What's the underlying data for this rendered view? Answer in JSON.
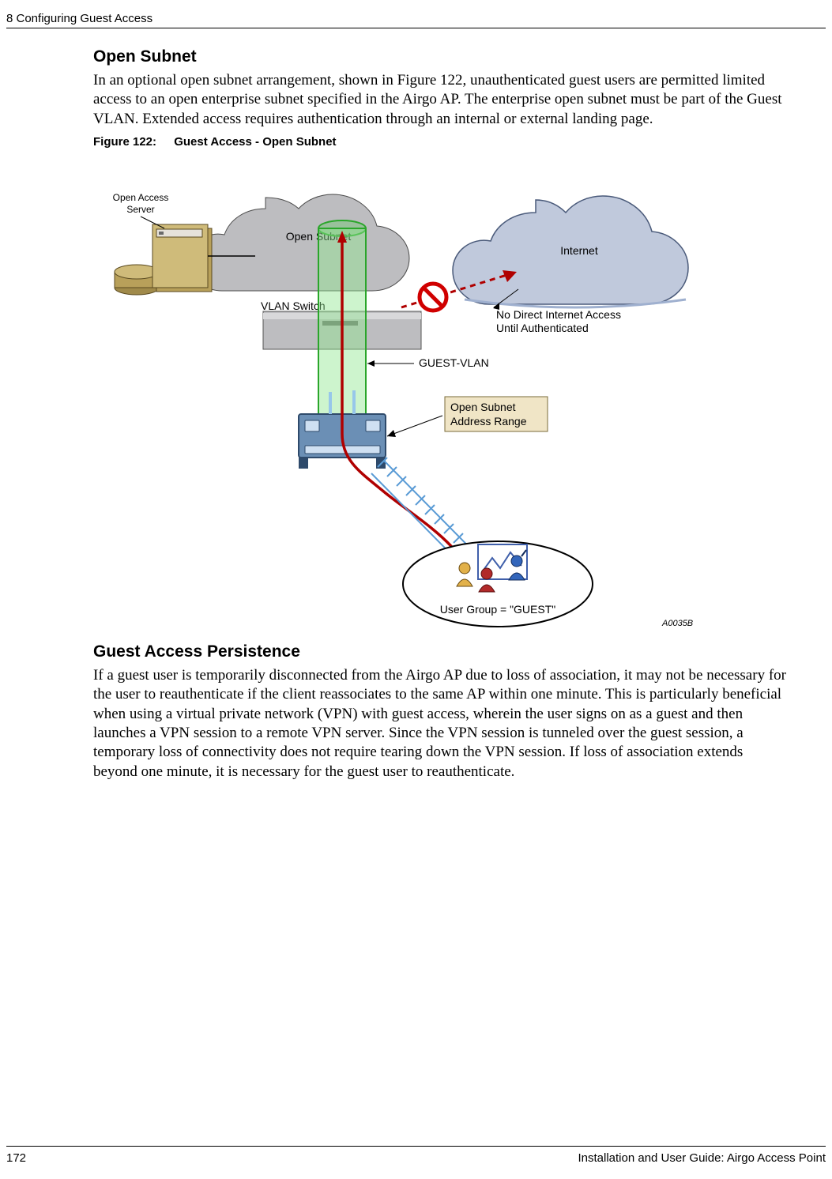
{
  "header": {
    "chapter_title": "8  Configuring Guest Access"
  },
  "section_open_subnet": {
    "title": "Open Subnet",
    "body": "In an optional open subnet arrangement, shown in Figure 122, unauthenticated guest users are permitted limited access to an open enterprise subnet specified in the Airgo AP. The enterprise open subnet must be part of the Guest VLAN. Extended access requires authentication through an internal or external landing page."
  },
  "figure": {
    "lead": "Figure 122:",
    "caption": "Guest Access - Open Subnet",
    "labels": {
      "open_access_server": "Open Access\nServer",
      "open_subnet_cloud": "Open Subnet",
      "internet_cloud": "Internet",
      "vlan_switch": "VLAN Switch",
      "no_direct_line1": "No Direct Internet Access",
      "no_direct_line2": "Until Authenticated",
      "guest_vlan": "GUEST-VLAN",
      "callout_line1": "Open Subnet",
      "callout_line2": "Address Range",
      "user_group": "User Group = \"GUEST\"",
      "ref": "A0035B"
    }
  },
  "section_persistence": {
    "title": "Guest Access Persistence",
    "body": "If a guest user is temporarily disconnected from the Airgo AP due to loss of association, it may not be necessary for the user to reauthenticate if the client reassociates to the same AP within one minute. This is particularly beneficial when using a virtual private network (VPN) with guest access, wherein the user signs on as a guest and then launches a VPN session to a remote VPN server. Since the VPN session is tunneled over the guest session, a temporary loss of connectivity does not require tearing down the VPN session. If loss of association extends beyond one minute, it is necessary for the guest user to reauthenticate."
  },
  "footer": {
    "page_number": "172",
    "doc_title": "Installation and User Guide: Airgo Access Point"
  }
}
